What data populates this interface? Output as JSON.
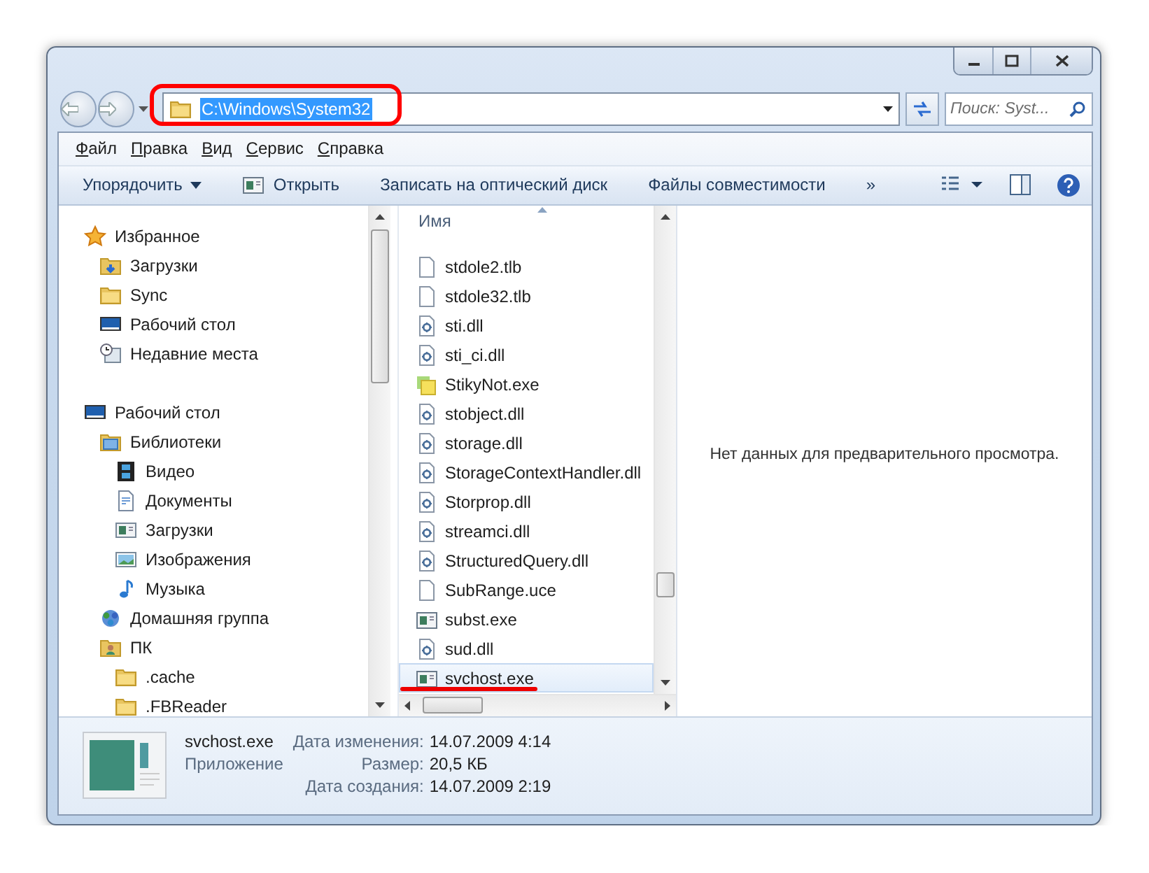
{
  "address_bar": {
    "path": "C:\\Windows\\System32",
    "selected": true,
    "annotated": true
  },
  "search": {
    "placeholder": "Поиск: Syst..."
  },
  "menu": [
    {
      "label": "Файл"
    },
    {
      "label": "Правка"
    },
    {
      "label": "Вид"
    },
    {
      "label": "Сервис"
    },
    {
      "label": "Справка"
    }
  ],
  "toolbar": [
    {
      "kind": "dropdown",
      "label": "Упорядочить"
    },
    {
      "kind": "open",
      "label": "Открыть"
    },
    {
      "kind": "plain",
      "label": "Записать на оптический диск"
    },
    {
      "kind": "plain",
      "label": "Файлы совместимости"
    },
    {
      "kind": "plain",
      "label": "»"
    }
  ],
  "navigation": [
    {
      "label": "Избранное",
      "kind": "star",
      "children": [
        {
          "label": "Загрузки",
          "kind": "downloads-folder"
        },
        {
          "label": "Sync",
          "kind": "folder"
        },
        {
          "label": "Рабочий стол",
          "kind": "desktop"
        },
        {
          "label": "Недавние места",
          "kind": "recent"
        }
      ]
    },
    {
      "label": "Рабочий стол",
      "kind": "desktop",
      "children": [
        {
          "label": "Библиотеки",
          "kind": "library",
          "children": [
            {
              "label": "Видео",
              "kind": "video"
            },
            {
              "label": "Документы",
              "kind": "document"
            },
            {
              "label": "Загрузки",
              "kind": "window"
            },
            {
              "label": "Изображения",
              "kind": "picture"
            },
            {
              "label": "Музыка",
              "kind": "music"
            }
          ]
        },
        {
          "label": "Домашняя группа",
          "kind": "homegroup"
        },
        {
          "label": "ПК",
          "kind": "user-folder",
          "children": [
            {
              "label": ".cache",
              "kind": "folder"
            },
            {
              "label": ".FBReader",
              "kind": "folder"
            }
          ]
        }
      ]
    }
  ],
  "file_list": {
    "column": "Имя",
    "files": [
      {
        "name": "stdole2.tlb",
        "kind": "blank",
        "selected": false
      },
      {
        "name": "stdole32.tlb",
        "kind": "blank",
        "selected": false
      },
      {
        "name": "sti.dll",
        "kind": "dll",
        "selected": false
      },
      {
        "name": "sti_ci.dll",
        "kind": "dll",
        "selected": false
      },
      {
        "name": "StikyNot.exe",
        "kind": "sticky",
        "selected": false
      },
      {
        "name": "stobject.dll",
        "kind": "dll",
        "selected": false
      },
      {
        "name": "storage.dll",
        "kind": "dll",
        "selected": false
      },
      {
        "name": "StorageContextHandler.dll",
        "kind": "dll",
        "selected": false
      },
      {
        "name": "Storprop.dll",
        "kind": "dll",
        "selected": false
      },
      {
        "name": "streamci.dll",
        "kind": "dll",
        "selected": false
      },
      {
        "name": "StructuredQuery.dll",
        "kind": "dll",
        "selected": false
      },
      {
        "name": "SubRange.uce",
        "kind": "blank",
        "selected": false
      },
      {
        "name": "subst.exe",
        "kind": "exe",
        "selected": false
      },
      {
        "name": "sud.dll",
        "kind": "dll",
        "selected": false
      },
      {
        "name": "svchost.exe",
        "kind": "exe",
        "selected": true,
        "annotated": true
      }
    ]
  },
  "preview": {
    "message": "Нет данных для предварительного просмотра."
  },
  "details": {
    "name": "svchost.exe",
    "type": "Приложение",
    "properties": [
      {
        "label": "Дата изменения:",
        "value": "14.07.2009 4:14"
      },
      {
        "label": "Размер:",
        "value": "20,5 КБ"
      },
      {
        "label": "Дата создания:",
        "value": "14.07.2009 2:19"
      }
    ]
  }
}
